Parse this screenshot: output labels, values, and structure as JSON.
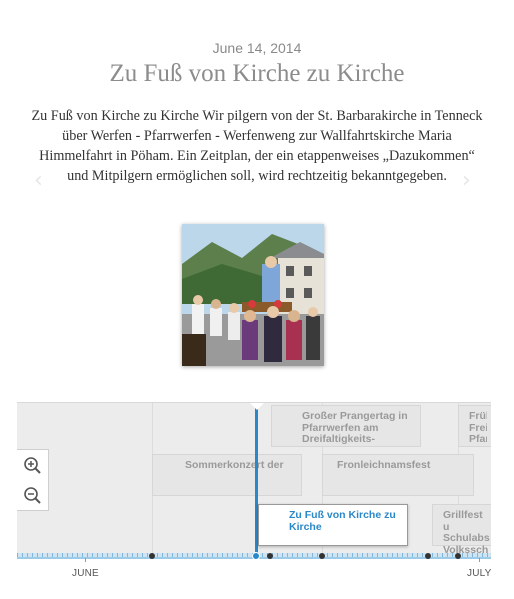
{
  "post": {
    "date": "June 14, 2014",
    "title": "Zu Fuß von Kirche zu Kirche",
    "body": "Zu Fuß von Kirche zu Kirche Wir pilgern von der St. Barbarakirche in Tenneck über Werfen - Pfarrwerfen - Werfenweng zur Wallfahrtskirche Maria Himmelfahrt in Pöham. Ein Zeitplan, der ein etappenweises „Dazukommen“ und Mitpilgern ermöglichen soll, wird rechtzeitig bekanntgegeben."
  },
  "nav": {
    "prev_icon": "‹",
    "next_icon": "›"
  },
  "timeline": {
    "events": [
      {
        "label": "Großer Prangertag in Pfarrwerfen am Dreifaltigkeits-"
      },
      {
        "label": "Früh Freit Pfar"
      },
      {
        "label": "Sommerkonzert der"
      },
      {
        "label": "Fronleichnamsfest"
      },
      {
        "label": "Zu Fuß von Kirche zu Kirche",
        "active": true
      },
      {
        "label": "Grillfest u Schulabs Volkssch"
      }
    ],
    "months": [
      "JUNE",
      "JULY"
    ],
    "zoom_in_icon": "zoom-in",
    "zoom_out_icon": "zoom-out",
    "accent_color": "#2a88c8"
  }
}
